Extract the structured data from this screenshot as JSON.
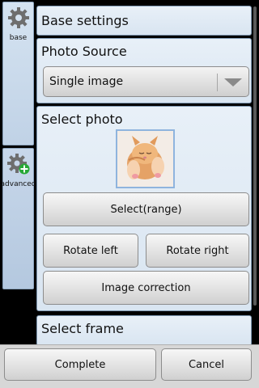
{
  "tabs": [
    {
      "label": "base"
    },
    {
      "label": "advanced"
    }
  ],
  "base_settings": {
    "title": "Base settings"
  },
  "photo_source": {
    "title": "Photo Source",
    "selected": "Single image"
  },
  "select_photo": {
    "title": "Select photo",
    "select_range": "Select(range)",
    "rotate_left": "Rotate left",
    "rotate_right": "Rotate right",
    "image_correction": "Image correction"
  },
  "select_frame": {
    "title": "Select frame"
  },
  "actions": {
    "complete": "Complete",
    "cancel": "Cancel"
  },
  "colors": {
    "panel": "#e8f0f8",
    "border": "#7e98b2",
    "tab": "#d5e3f1"
  }
}
